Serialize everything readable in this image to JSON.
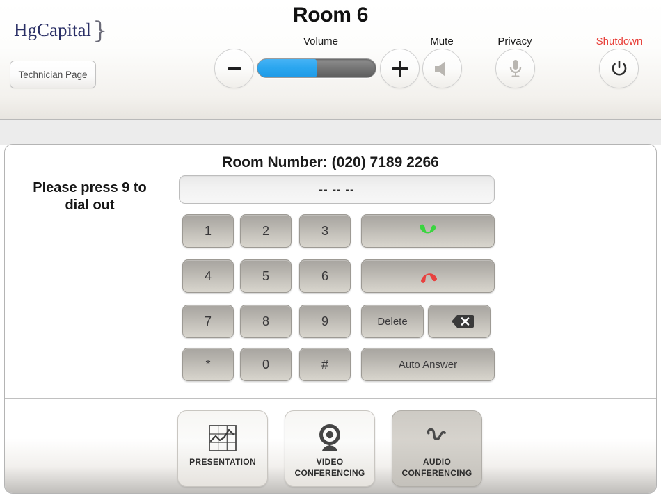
{
  "header": {
    "logo_text": "HgCapital",
    "logo_brace": "}",
    "technician_button": "Technician Page",
    "room_title": "Room 6",
    "volume_label": "Volume",
    "mute_label": "Mute",
    "privacy_label": "Privacy",
    "shutdown_label": "Shutdown",
    "volume_percent": 50,
    "icons": {
      "minus": "minus-icon",
      "plus": "plus-icon",
      "mute": "speaker-icon",
      "privacy": "microphone-icon",
      "shutdown": "power-icon"
    },
    "colors": {
      "slider_fill": "#2aa6ef",
      "shutdown_text": "#e8403a",
      "logo": "#2a2f66"
    }
  },
  "dialer": {
    "room_number_label": "Room Number: (020) 7189 2266",
    "display_value": "-- -- --",
    "instruction": "Please press 9 to dial out",
    "keys": [
      {
        "label": "1",
        "name": "key-1",
        "type": "num"
      },
      {
        "label": "2",
        "name": "key-2",
        "type": "num"
      },
      {
        "label": "3",
        "name": "key-3",
        "type": "num"
      },
      {
        "label": "4",
        "name": "key-4",
        "type": "num"
      },
      {
        "label": "5",
        "name": "key-5",
        "type": "num"
      },
      {
        "label": "6",
        "name": "key-6",
        "type": "num"
      },
      {
        "label": "7",
        "name": "key-7",
        "type": "num"
      },
      {
        "label": "8",
        "name": "key-8",
        "type": "num"
      },
      {
        "label": "9",
        "name": "key-9",
        "type": "num"
      },
      {
        "label": "*",
        "name": "key-star",
        "type": "num"
      },
      {
        "label": "0",
        "name": "key-0",
        "type": "num"
      },
      {
        "label": "#",
        "name": "key-hash",
        "type": "num"
      }
    ],
    "call_button": {
      "name": "call-button",
      "icon": "phone-handset-green-icon",
      "color": "#3ad53f"
    },
    "hangup_button": {
      "name": "hangup-button",
      "icon": "phone-handset-red-icon",
      "color": "#e8413f"
    },
    "delete_button": "Delete",
    "backspace_button": {
      "name": "backspace-button",
      "icon": "backspace-icon",
      "glyph": "x"
    },
    "auto_answer_button": "Auto Answer"
  },
  "modes": [
    {
      "label_line1": "PRESENTATION",
      "label_line2": "",
      "icon": "chart-grid-icon",
      "selected": false,
      "name": "presentation-mode-button"
    },
    {
      "label_line1": "VIDEO",
      "label_line2": "CONFERENCING",
      "icon": "webcam-icon",
      "selected": false,
      "name": "video-conferencing-mode-button"
    },
    {
      "label_line1": "AUDIO",
      "label_line2": "CONFERENCING",
      "icon": "phone-handset-icon",
      "selected": true,
      "name": "audio-conferencing-mode-button"
    }
  ]
}
